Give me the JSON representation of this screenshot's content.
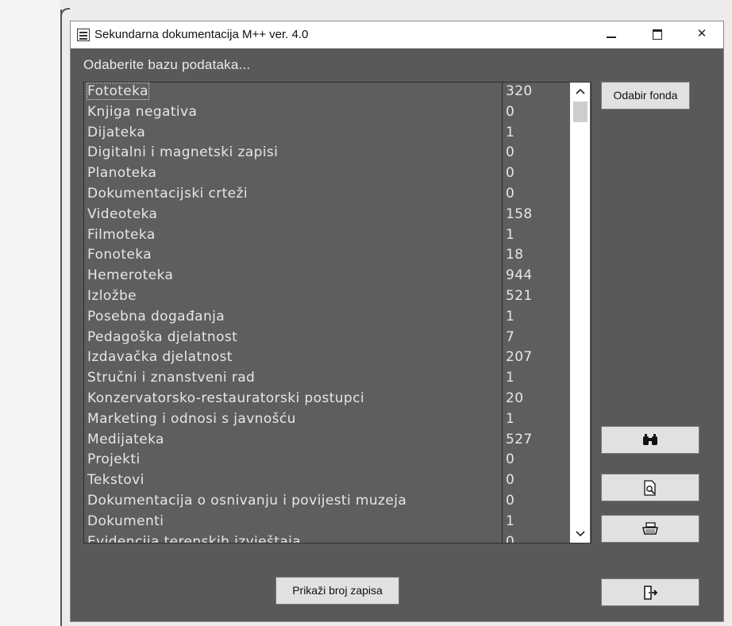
{
  "window": {
    "title": "Sekundarna dokumentacija M++ ver. 4.0",
    "controls": {
      "minimize": "minimize-icon",
      "maximize": "maximize-icon",
      "close": "✕"
    }
  },
  "prompt": "Odaberite bazu podataka...",
  "list": {
    "selected_index": 0,
    "rows": [
      {
        "name": "Fototeka",
        "count": "320"
      },
      {
        "name": "Knjiga negativa",
        "count": "0"
      },
      {
        "name": "Dijateka",
        "count": "1"
      },
      {
        "name": "Digitalni i magnetski zapisi",
        "count": "0"
      },
      {
        "name": "Planoteka",
        "count": "0"
      },
      {
        "name": "Dokumentacijski crteži",
        "count": "0"
      },
      {
        "name": "Videoteka",
        "count": "158"
      },
      {
        "name": "Filmoteka",
        "count": "1"
      },
      {
        "name": "Fonoteka",
        "count": "18"
      },
      {
        "name": "Hemeroteka",
        "count": "944"
      },
      {
        "name": "Izložbe",
        "count": "521"
      },
      {
        "name": "Posebna događanja",
        "count": "1"
      },
      {
        "name": "Pedagoška djelatnost",
        "count": "7"
      },
      {
        "name": "Izdavačka djelatnost",
        "count": "207"
      },
      {
        "name": "Stručni i znanstveni rad",
        "count": "1"
      },
      {
        "name": "Konzervatorsko-restauratorski postupci",
        "count": "20"
      },
      {
        "name": "Marketing i odnosi s javnošću",
        "count": "1"
      },
      {
        "name": "Medijateka",
        "count": "527"
      },
      {
        "name": "Projekti",
        "count": "0"
      },
      {
        "name": "Tekstovi",
        "count": "0"
      },
      {
        "name": "Dokumentacija o osnivanju i povijesti muzeja",
        "count": "0"
      },
      {
        "name": "Dokumenti",
        "count": "1"
      },
      {
        "name": "Evidencija terenskih izvještaja",
        "count": "0"
      }
    ]
  },
  "buttons": {
    "odabir_fonda": "Odabir fonda",
    "prikazi_broj_zapisa": "Prikaži broj zapisa",
    "find_icon": "binoculars-icon",
    "preview_icon": "print-preview-icon",
    "print_icon": "printer-icon",
    "exit_icon": "exit-door-icon"
  },
  "scrollbar": {
    "up": "^",
    "down": "v"
  }
}
